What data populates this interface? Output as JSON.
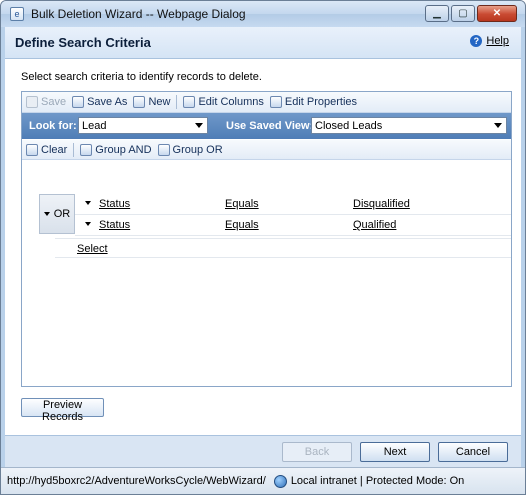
{
  "window": {
    "title": "Bulk Deletion Wizard -- Webpage Dialog"
  },
  "header": {
    "title": "Define Search Criteria",
    "help_label": "Help"
  },
  "instructions": "Select search criteria to identify records to delete.",
  "toolbar": {
    "save": "Save",
    "save_as": "Save As",
    "new": "New",
    "edit_columns": "Edit Columns",
    "edit_properties": "Edit Properties"
  },
  "lookfor": {
    "label": "Look for:",
    "value": "Lead",
    "saved_view_label": "Use Saved View:",
    "saved_view_value": "Closed Leads"
  },
  "toolbar2": {
    "clear": "Clear",
    "group_and": "Group AND",
    "group_or": "Group OR"
  },
  "criteria": {
    "group_label": "OR",
    "rows": [
      {
        "field": "Status",
        "operator": "Equals",
        "value": "Disqualified"
      },
      {
        "field": "Status",
        "operator": "Equals",
        "value": "Qualified"
      }
    ],
    "select_label": "Select"
  },
  "preview_button": "Preview Records",
  "footer": {
    "back": "Back",
    "next": "Next",
    "cancel": "Cancel"
  },
  "statusbar": {
    "url": "http://hyd5boxrc2/AdventureWorksCycle/WebWizard/",
    "zone": "Local intranet | Protected Mode: On"
  }
}
